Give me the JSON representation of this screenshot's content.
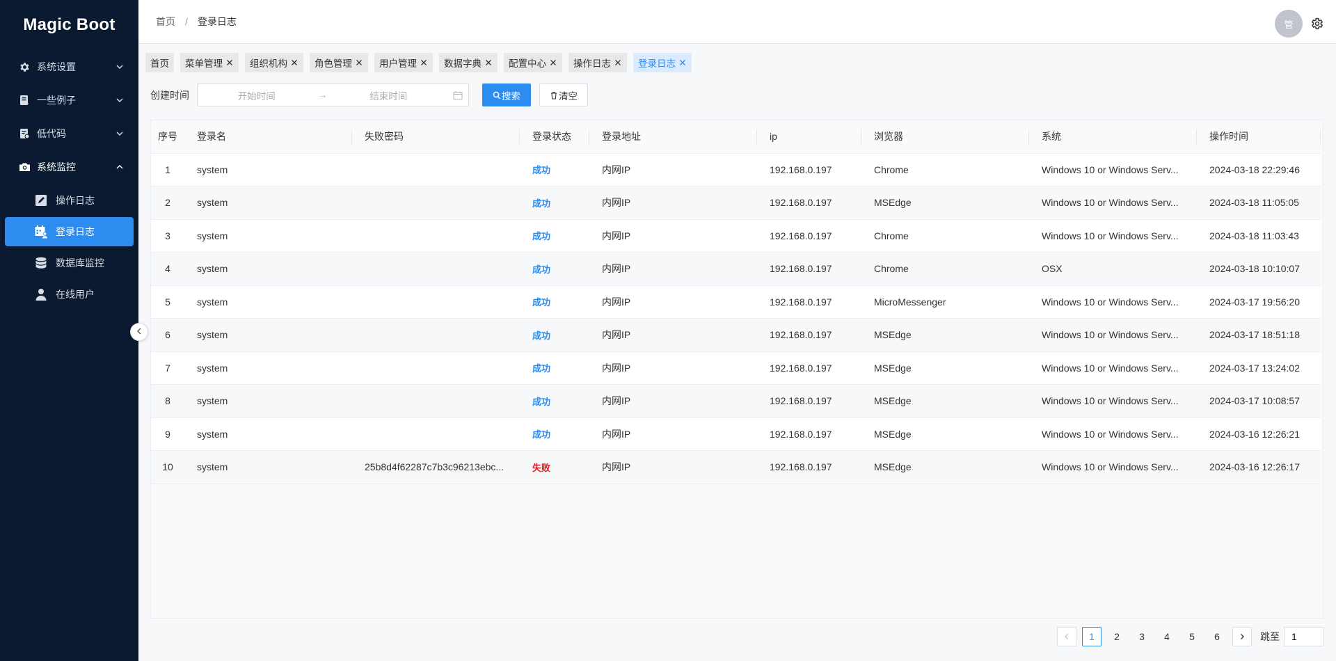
{
  "app": {
    "name": "Magic Boot"
  },
  "sidebar": {
    "groups": [
      {
        "label": "系统设置",
        "icon": "gear-icon",
        "expanded": false
      },
      {
        "label": "一些例子",
        "icon": "notebook-icon",
        "expanded": false
      },
      {
        "label": "低代码",
        "icon": "code-doc-icon",
        "expanded": false
      },
      {
        "label": "系统监控",
        "icon": "camera-icon",
        "expanded": true
      }
    ],
    "sub_items": [
      {
        "label": "操作日志",
        "icon": "edit-log-icon"
      },
      {
        "label": "登录日志",
        "icon": "calendar-user-icon",
        "active": true
      },
      {
        "label": "数据库监控",
        "icon": "database-icon"
      },
      {
        "label": "在线用户",
        "icon": "user-icon"
      }
    ]
  },
  "header": {
    "breadcrumb": [
      "首页",
      "登录日志"
    ],
    "separator": "/",
    "avatar_text": "管"
  },
  "tabs": [
    {
      "label": "首页",
      "closable": false
    },
    {
      "label": "菜单管理",
      "closable": true
    },
    {
      "label": "组织机构",
      "closable": true
    },
    {
      "label": "角色管理",
      "closable": true
    },
    {
      "label": "用户管理",
      "closable": true
    },
    {
      "label": "数据字典",
      "closable": true
    },
    {
      "label": "配置中心",
      "closable": true
    },
    {
      "label": "操作日志",
      "closable": true
    },
    {
      "label": "登录日志",
      "closable": true,
      "active": true
    }
  ],
  "search": {
    "label": "创建时间",
    "start_placeholder": "开始时间",
    "arrow": "→",
    "end_placeholder": "结束时间",
    "search_button": "搜索",
    "clear_button": "清空"
  },
  "table": {
    "columns": [
      "序号",
      "登录名",
      "失败密码",
      "登录状态",
      "登录地址",
      "ip",
      "浏览器",
      "系统",
      "操作时间"
    ],
    "rows": [
      {
        "idx": "1",
        "name": "system",
        "pwd": "",
        "status": "成功",
        "ok": true,
        "addr": "内网IP",
        "ip": "192.168.0.197",
        "browser": "Chrome",
        "os": "Windows 10 or Windows Serv...",
        "time": "2024-03-18 22:29:46"
      },
      {
        "idx": "2",
        "name": "system",
        "pwd": "",
        "status": "成功",
        "ok": true,
        "addr": "内网IP",
        "ip": "192.168.0.197",
        "browser": "MSEdge",
        "os": "Windows 10 or Windows Serv...",
        "time": "2024-03-18 11:05:05"
      },
      {
        "idx": "3",
        "name": "system",
        "pwd": "",
        "status": "成功",
        "ok": true,
        "addr": "内网IP",
        "ip": "192.168.0.197",
        "browser": "Chrome",
        "os": "Windows 10 or Windows Serv...",
        "time": "2024-03-18 11:03:43"
      },
      {
        "idx": "4",
        "name": "system",
        "pwd": "",
        "status": "成功",
        "ok": true,
        "addr": "内网IP",
        "ip": "192.168.0.197",
        "browser": "Chrome",
        "os": "OSX",
        "time": "2024-03-18 10:10:07"
      },
      {
        "idx": "5",
        "name": "system",
        "pwd": "",
        "status": "成功",
        "ok": true,
        "addr": "内网IP",
        "ip": "192.168.0.197",
        "browser": "MicroMessenger",
        "os": "Windows 10 or Windows Serv...",
        "time": "2024-03-17 19:56:20"
      },
      {
        "idx": "6",
        "name": "system",
        "pwd": "",
        "status": "成功",
        "ok": true,
        "addr": "内网IP",
        "ip": "192.168.0.197",
        "browser": "MSEdge",
        "os": "Windows 10 or Windows Serv...",
        "time": "2024-03-17 18:51:18"
      },
      {
        "idx": "7",
        "name": "system",
        "pwd": "",
        "status": "成功",
        "ok": true,
        "addr": "内网IP",
        "ip": "192.168.0.197",
        "browser": "MSEdge",
        "os": "Windows 10 or Windows Serv...",
        "time": "2024-03-17 13:24:02"
      },
      {
        "idx": "8",
        "name": "system",
        "pwd": "",
        "status": "成功",
        "ok": true,
        "addr": "内网IP",
        "ip": "192.168.0.197",
        "browser": "MSEdge",
        "os": "Windows 10 or Windows Serv...",
        "time": "2024-03-17 10:08:57"
      },
      {
        "idx": "9",
        "name": "system",
        "pwd": "",
        "status": "成功",
        "ok": true,
        "addr": "内网IP",
        "ip": "192.168.0.197",
        "browser": "MSEdge",
        "os": "Windows 10 or Windows Serv...",
        "time": "2024-03-16 12:26:21"
      },
      {
        "idx": "10",
        "name": "system",
        "pwd": "25b8d4f62287c7b3c96213ebc...",
        "status": "失败",
        "ok": false,
        "addr": "内网IP",
        "ip": "192.168.0.197",
        "browser": "MSEdge",
        "os": "Windows 10 or Windows Serv...",
        "time": "2024-03-16 12:26:17"
      }
    ]
  },
  "pagination": {
    "pages": [
      "1",
      "2",
      "3",
      "4",
      "5",
      "6"
    ],
    "current": "1",
    "jump_label": "跳至",
    "jump_value": "1"
  },
  "colors": {
    "sidebar_bg": "#0b1a30",
    "accent": "#2d8cf0",
    "success": "#2d8cf0",
    "fail": "#e02020"
  }
}
